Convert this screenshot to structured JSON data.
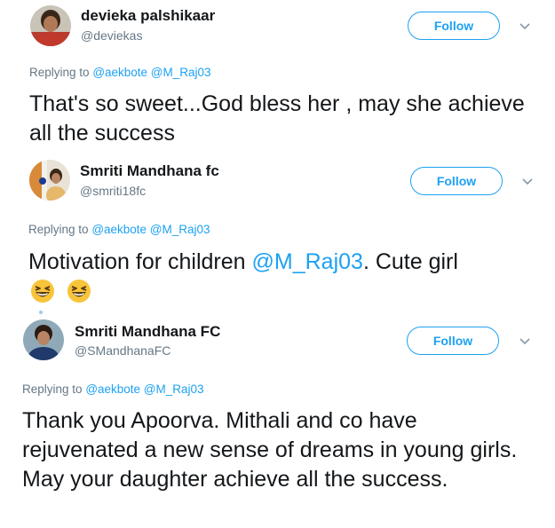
{
  "tweets": [
    {
      "name": "devieka palshikaar",
      "handle": "@deviekas",
      "follow_label": "Follow",
      "replying_prefix": "Replying to",
      "replying_to": "@aekbote @M_Raj03",
      "text": "That's so sweet...God bless her , may she achieve all the success"
    },
    {
      "name": "Smriti Mandhana fc",
      "handle": "@smriti18fc",
      "follow_label": "Follow",
      "replying_prefix": "Replying to",
      "replying_to": "@aekbote @M_Raj03",
      "text_before": "Motivation for children ",
      "mention": "@M_Raj03",
      "text_after": ". Cute girl"
    },
    {
      "name": "Smriti Mandhana FC",
      "handle": "@SMandhanaFC",
      "follow_label": "Follow",
      "replying_prefix": "Replying to",
      "replying_to": "@aekbote @M_Raj03",
      "text": "Thank you Apoorva. Mithali and co have rejuvenated a new sense of dreams in young girls. May your daughter achieve all the success."
    }
  ],
  "colors": {
    "accent": "#1da1f2",
    "secondary_text": "#657786",
    "primary_text": "#14171a"
  },
  "icons": [
    "chevron-down-icon",
    "grinning-squinting-face-emoji"
  ]
}
